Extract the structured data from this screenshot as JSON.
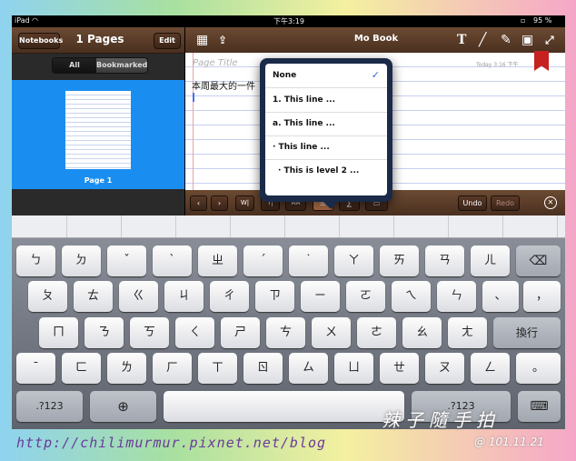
{
  "status": {
    "carrier": "iPad",
    "time": "下午3:19",
    "battery": "95 %"
  },
  "left_panel": {
    "notebooks_label": "Notebooks",
    "title": "1 Pages",
    "edit_label": "Edit",
    "filter_all": "All",
    "filter_bookmarked": "Bookmarked",
    "page_label": "Page 1"
  },
  "toolbar": {
    "app_title": "Mo Book",
    "text_tool": "T"
  },
  "note": {
    "page_title_placeholder": "Page Title",
    "date": "Today 3:16 下午",
    "body_text": "本周最大的一件"
  },
  "bottom_bar": {
    "font_size_label": "AA",
    "undo_label": "Undo",
    "redo_label": "Redo"
  },
  "list_menu": {
    "items": [
      {
        "label": "None",
        "selected": true
      },
      {
        "label": "1. This line ..."
      },
      {
        "label": "a. This line ..."
      },
      {
        "label": "· This line ..."
      },
      {
        "label": "· This is level 2 ..."
      }
    ]
  },
  "keyboard": {
    "row1": [
      "ㄅ",
      "ㄉ",
      "ˇ",
      "ˋ",
      "ㄓ",
      "ˊ",
      "˙",
      "ㄚ",
      "ㄞ",
      "ㄢ",
      "ㄦ"
    ],
    "row2": [
      "ㄆ",
      "ㄊ",
      "ㄍ",
      "ㄐ",
      "ㄔ",
      "ㄗ",
      "ㄧ",
      "ㄛ",
      "ㄟ",
      "ㄣ",
      "、",
      "，"
    ],
    "row3": [
      "ㄇ",
      "ㄋ",
      "ㄎ",
      "ㄑ",
      "ㄕ",
      "ㄘ",
      "ㄨ",
      "ㄜ",
      "ㄠ",
      "ㄤ"
    ],
    "return_label": "換行",
    "row4": [
      "ˉ",
      "ㄈ",
      "ㄌ",
      "ㄏ",
      "ㄒ",
      "ㄖ",
      "ㄙ",
      "ㄩ",
      "ㄝ",
      "ㄡ",
      "ㄥ",
      "。"
    ],
    "numbers_label": ".?123",
    "numbers_label_right": ".?123"
  },
  "overlay": {
    "watermark": "辣子隨手拍",
    "blog_url": "http://chilimurmur.pixnet.net/blog",
    "photo_date": "@ 101.11.21"
  }
}
